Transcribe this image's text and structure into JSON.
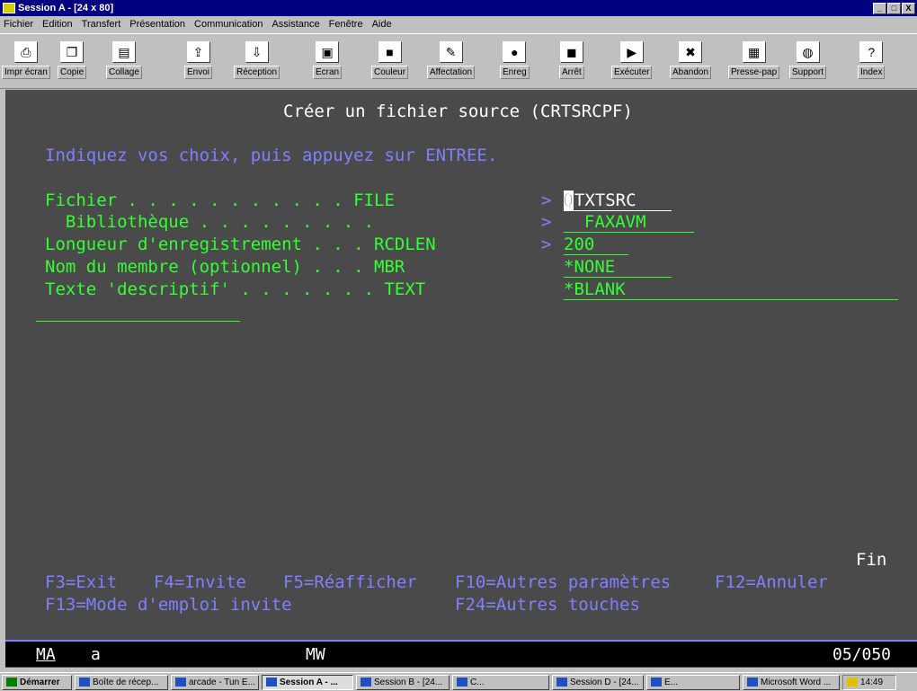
{
  "window": {
    "title": "Session A - [24 x 80]",
    "controls": [
      "_",
      "□",
      "X"
    ]
  },
  "menu": [
    "Fichier",
    "Edition",
    "Transfert",
    "Présentation",
    "Communication",
    "Assistance",
    "Fenêtre",
    "Aide"
  ],
  "toolbar": [
    {
      "label": "Impr écran",
      "icon": "print-icon"
    },
    {
      "label": "Copie",
      "icon": "copy-icon"
    },
    {
      "label": "Collage",
      "icon": "paste-icon"
    },
    {
      "label": "Envoi",
      "icon": "send-icon"
    },
    {
      "label": "Réception",
      "icon": "receive-icon"
    },
    {
      "label": "Ecran",
      "icon": "screen-icon"
    },
    {
      "label": "Couleur",
      "icon": "color-icon"
    },
    {
      "label": "Affectation",
      "icon": "keymap-icon"
    },
    {
      "label": "Enreg",
      "icon": "record-icon"
    },
    {
      "label": "Arrêt",
      "icon": "stop-icon"
    },
    {
      "label": "Exécuter",
      "icon": "play-icon"
    },
    {
      "label": "Abandon",
      "icon": "abort-icon"
    },
    {
      "label": "Presse-pap",
      "icon": "clipboard-icon"
    },
    {
      "label": "Support",
      "icon": "globe-icon"
    },
    {
      "label": "Index",
      "icon": "help-book-icon"
    }
  ],
  "screen": {
    "title": "Créer un fichier source (CRTSRCPF)",
    "instruction": "Indiquez vos choix, puis appuyez sur ENTREE.",
    "fields": [
      {
        "label": "Fichier . . . . . . . . . . . FILE",
        "marker": ">",
        "value": "QTXTSRC"
      },
      {
        "label": "  Bibliothèque . . . . . . . . .",
        "marker": ">",
        "value": "  FAXAVM"
      },
      {
        "label": "Longueur d'enregistrement . . . RCDLEN",
        "marker": ">",
        "value": "200"
      },
      {
        "label": "Nom du membre (optionnel) . . . MBR",
        "marker": "",
        "value": "*NONE"
      },
      {
        "label": "Texte 'descriptif' . . . . . . . TEXT",
        "marker": "",
        "value": "*BLANK"
      }
    ],
    "end_marker": "Fin",
    "fkeys_line1": [
      "F3=Exit",
      "F4=Invite",
      "F5=Réafficher",
      "F10=Autres paramètres",
      "F12=Annuler"
    ],
    "fkeys_line2": [
      "F13=Mode d'emploi invite",
      "F24=Autres touches"
    ]
  },
  "status": {
    "mode": "MA",
    "indicator": "a",
    "mw": "MW",
    "position": "05/050"
  },
  "taskbar": [
    {
      "label": "Démarrer",
      "start": true
    },
    {
      "label": "Boîte de récep..."
    },
    {
      "label": "arcade - Tun E..."
    },
    {
      "label": "Session A - ...",
      "active": true
    },
    {
      "label": "Session B - [24..."
    },
    {
      "label": "C..."
    },
    {
      "label": "Session D - [24..."
    },
    {
      "label": "E..."
    },
    {
      "label": "Microsoft Word ..."
    },
    {
      "label": "14:49"
    }
  ]
}
